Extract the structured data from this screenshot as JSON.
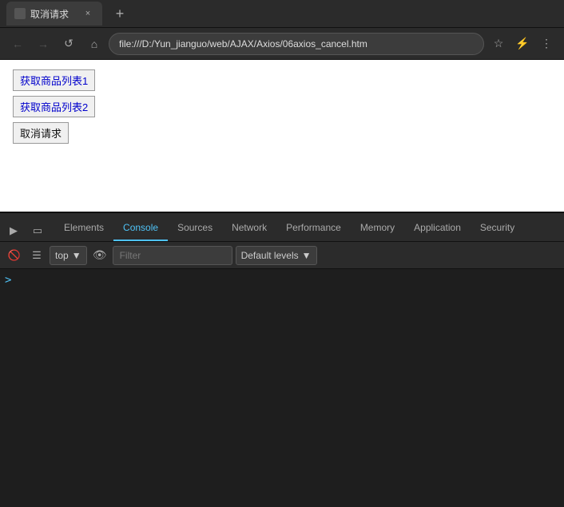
{
  "browser": {
    "tab_title": "取消请求",
    "new_tab_label": "+",
    "tab_close": "×"
  },
  "nav": {
    "address": "file:///D:/Yun_jianguo/web/AJAX/Axios/06axios_cancel.htm",
    "back_icon": "←",
    "forward_icon": "→",
    "refresh_icon": "↺",
    "home_icon": "⌂",
    "star_icon": "☆",
    "extensions_icon": "⚡",
    "menu_icon": "⋮"
  },
  "page": {
    "btn1_label": "获取商品列表1",
    "btn2_label": "获取商品列表2",
    "btn3_label": "取消请求"
  },
  "devtools": {
    "tabs": [
      {
        "id": "elements",
        "label": "Elements"
      },
      {
        "id": "console",
        "label": "Console"
      },
      {
        "id": "sources",
        "label": "Sources"
      },
      {
        "id": "network",
        "label": "Network"
      },
      {
        "id": "performance",
        "label": "Performance"
      },
      {
        "id": "memory",
        "label": "Memory"
      },
      {
        "id": "application",
        "label": "Application"
      },
      {
        "id": "security",
        "label": "Security"
      }
    ],
    "active_tab": "console",
    "console": {
      "context": "top",
      "filter_placeholder": "Filter",
      "levels_label": "Default levels",
      "prompt_symbol": ">"
    }
  }
}
